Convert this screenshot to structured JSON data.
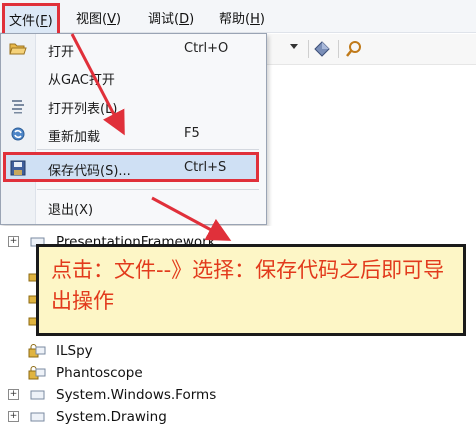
{
  "menubar": {
    "file": {
      "label": "文件(",
      "key": "F",
      "end": ")"
    },
    "view": {
      "label": "视图(",
      "key": "V",
      "end": ")"
    },
    "debug": {
      "label": "调试(",
      "key": "D",
      "end": ")"
    },
    "help": {
      "label": "帮助(",
      "key": "H",
      "end": ")"
    }
  },
  "file_menu": {
    "items": [
      {
        "label": "打开",
        "shortcut": "Ctrl+O",
        "icon": "open-folder-icon"
      },
      {
        "label": "从GAC打开",
        "shortcut": "",
        "icon": ""
      },
      {
        "label": "打开列表(L)",
        "shortcut": "",
        "icon": "list-icon"
      },
      {
        "label": "重新加载",
        "shortcut": "F5",
        "icon": "reload-icon"
      },
      {
        "label": "保存代码(S)...",
        "shortcut": "Ctrl+S",
        "icon": "save-icon"
      },
      {
        "label": "退出(X)",
        "shortcut": "",
        "icon": ""
      }
    ]
  },
  "tree": {
    "items": [
      {
        "label": "PresentationFramework",
        "expandable": true
      },
      {
        "label": "ILSpy",
        "expandable": false
      },
      {
        "label": "Phantoscope",
        "expandable": false
      },
      {
        "label": "System.Windows.Forms",
        "expandable": true
      },
      {
        "label": "System.Drawing",
        "expandable": true
      }
    ]
  },
  "annotation": {
    "text": "点击：文件--》选择：保存代码之后即可导出操作"
  },
  "colors": {
    "highlight_border": "#e0303a",
    "annotation_text": "#e23a1c",
    "annotation_bg": "#fdf6c6"
  }
}
